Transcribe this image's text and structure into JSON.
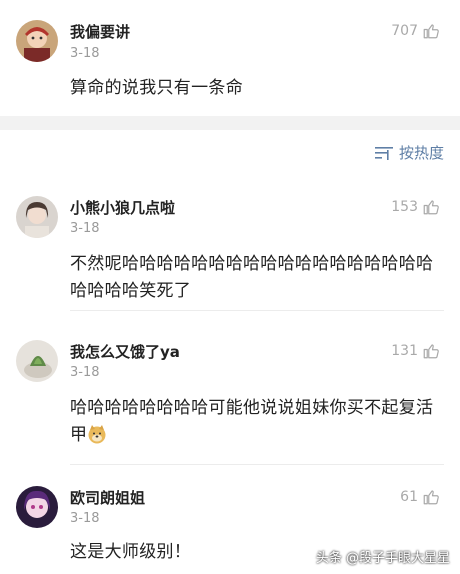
{
  "main_post": {
    "user": "我偏要讲",
    "date": "3-18",
    "likes": "707",
    "text": "算命的说我只有一条命"
  },
  "sort": {
    "label": "按热度",
    "icon": "sort-icon"
  },
  "comments": [
    {
      "user": "小熊小狼几点啦",
      "date": "3-18",
      "likes": "153",
      "text": "不然呢哈哈哈哈哈哈哈哈哈哈哈哈哈哈哈哈哈哈哈哈哈哈笑死了"
    },
    {
      "user": "我怎么又饿了ya",
      "date": "3-18",
      "likes": "131",
      "text": "哈哈哈哈哈哈哈哈可能他说说姐妹你买不起复活甲",
      "emoji": "doge-emoji"
    },
    {
      "user": "欧司朗姐姐",
      "date": "3-18",
      "likes": "61",
      "text": "这是大师级别！"
    }
  ],
  "watermark": "头条 @段子手眼大星星",
  "icons": {
    "like": "thumbs-up-icon"
  },
  "colors": {
    "link": "#5f7fa6",
    "meta": "#9a9a9a",
    "band": "#f2f2f2"
  }
}
